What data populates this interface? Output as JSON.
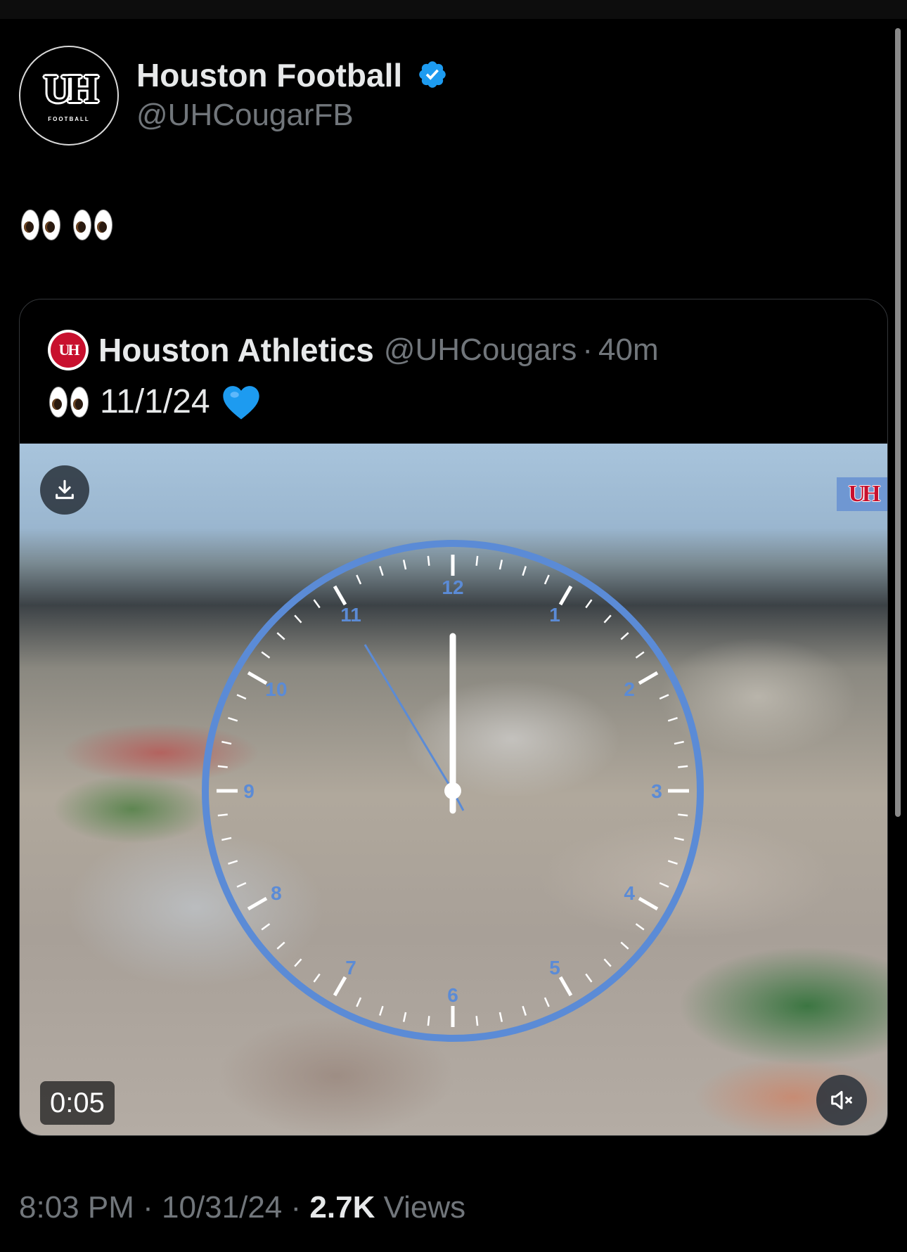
{
  "author": {
    "name": "Houston Football",
    "handle": "@UHCougarFB",
    "avatar_text": "UH",
    "avatar_subtext": "FOOTBALL",
    "verified_icon": "verified-badge-icon",
    "verified_color": "#1d9bf0"
  },
  "tweet": {
    "text_emoji": "eyes eyes"
  },
  "quoted": {
    "avatar_text": "UH",
    "name": "Houston Athletics",
    "handle": "@UHCougars",
    "separator": "·",
    "time": "40m",
    "text": "11/1/24",
    "heart_color": "#1d9bf0",
    "media": {
      "download_icon": "download-icon",
      "watermark": "UH",
      "clock_numbers": [
        "12",
        "1",
        "2",
        "3",
        "4",
        "5",
        "6",
        "7",
        "8",
        "9",
        "10",
        "11"
      ],
      "clock_color": "#5b8bd6",
      "elapsed": "0:05",
      "mute_icon": "speaker-muted-icon"
    }
  },
  "meta": {
    "time": "8:03 PM",
    "sep1": "·",
    "date": "10/31/24",
    "sep2": "·",
    "views_count": "2.7K",
    "views_label": "Views"
  }
}
